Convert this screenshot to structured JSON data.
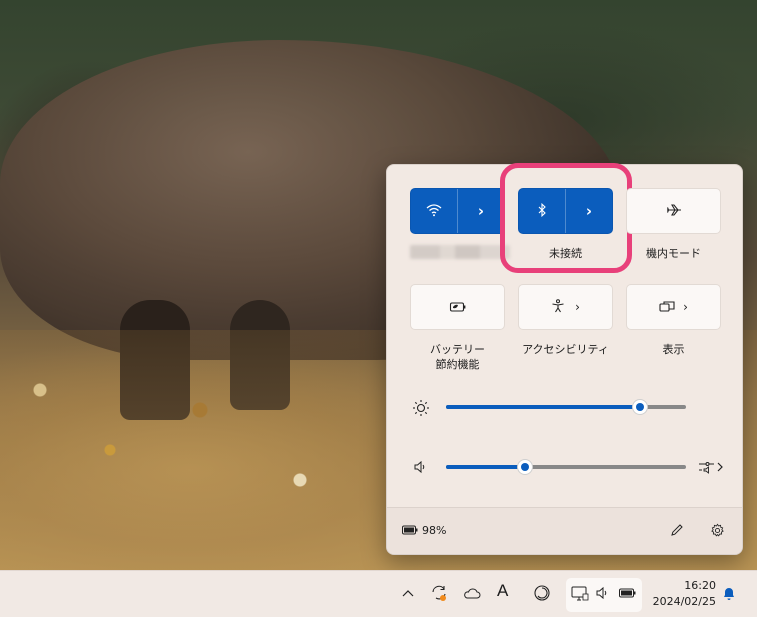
{
  "quick_settings": {
    "wifi": {
      "label": "",
      "icon": "wifi-icon",
      "state": "on"
    },
    "bluetooth": {
      "label": "未接続",
      "icon": "bluetooth-icon",
      "state": "on"
    },
    "airplane": {
      "label": "機内モード",
      "icon": "airplane-icon",
      "state": "off"
    },
    "battery_saver": {
      "label_line1": "バッテリー",
      "label_line2": "節約機能",
      "icon": "battery-saver-icon"
    },
    "accessibility": {
      "label": "アクセシビリティ",
      "icon": "accessibility-icon"
    },
    "display": {
      "label": "表示",
      "icon": "project-display-icon"
    },
    "chevron": "›",
    "brightness": {
      "icon": "brightness-icon",
      "level": 0.81
    },
    "volume": {
      "icon": "speaker-icon",
      "level": 0.33,
      "output_icon": "audio-output-icon"
    },
    "footer": {
      "battery_text": "98%",
      "edit_icon": "pencil-icon",
      "settings_icon": "gear-icon"
    }
  },
  "taskbar": {
    "time": "16:20",
    "date": "2024/02/25",
    "tray_icons": [
      "chevron-up-icon",
      "sync-icon",
      "onedrive-icon",
      "ime-icon",
      "focus-icon",
      "network-icon",
      "speaker-icon",
      "battery-icon",
      "notification-bell-icon"
    ],
    "ime_label": "A"
  },
  "colors": {
    "accent": "#0b5dbd",
    "highlight": "#e8407a",
    "panel_bg": "#f2e9e3"
  }
}
